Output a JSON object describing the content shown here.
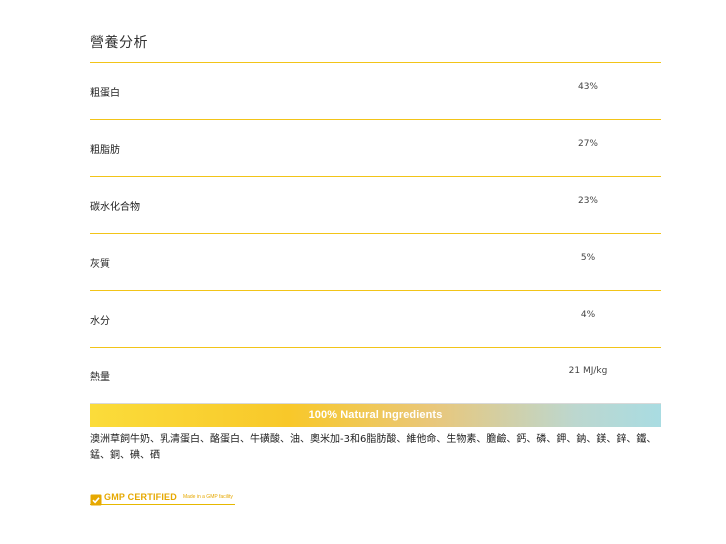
{
  "section": {
    "title": "營養分析"
  },
  "nutrition": [
    {
      "label": "粗蛋白",
      "value": "43%"
    },
    {
      "label": "粗脂肪",
      "value": "27%"
    },
    {
      "label": "碳水化合物",
      "value": "23%"
    },
    {
      "label": "灰質",
      "value": "5%"
    },
    {
      "label": "水分",
      "value": "4%"
    },
    {
      "label": "熱量",
      "value": "21 MJ/kg"
    }
  ],
  "banner": {
    "text": "100% Natural Ingredients"
  },
  "ingredients": {
    "text": "澳洲草飼牛奶、乳清蛋白、酪蛋白、牛磺酸、油、奧米加-3和6脂肪酸、維他命、生物素、膽鹼、鈣、磷、鉀、鈉、鎂、鋅、鐵、錳、銅、碘、硒"
  },
  "badge": {
    "label": "GMP CERTIFIED",
    "sub": "Made in a GMP facility"
  },
  "colors": {
    "accent": "#f2c418",
    "gradient_start": "#fbdc3a",
    "gradient_end": "#a9dce2"
  }
}
